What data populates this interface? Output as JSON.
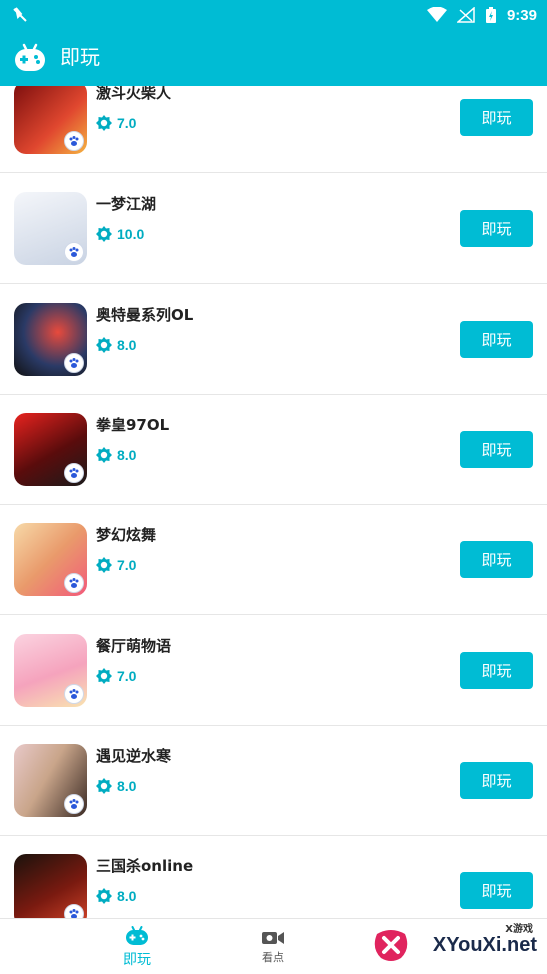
{
  "status_bar": {
    "time": "9:39"
  },
  "app_bar": {
    "title": "即玩"
  },
  "games": [
    {
      "name": "激斗火柴人",
      "score": "7.0",
      "button": "即玩",
      "bg": "#c0392b"
    },
    {
      "name": "一梦江湖",
      "score": "10.0",
      "button": "即玩",
      "bg": "#e8ecf2"
    },
    {
      "name": "奥特曼系列OL",
      "score": "8.0",
      "button": "即玩",
      "bg": "#1e2a44"
    },
    {
      "name": "拳皇97OL",
      "score": "8.0",
      "button": "即玩",
      "bg": "#8b1a1a"
    },
    {
      "name": "梦幻炫舞",
      "score": "7.0",
      "button": "即玩",
      "bg": "#f2c28a"
    },
    {
      "name": "餐厅萌物语",
      "score": "7.0",
      "button": "即玩",
      "bg": "#f7b6c8"
    },
    {
      "name": "遇见逆水寒",
      "score": "8.0",
      "button": "即玩",
      "bg": "#d9c3b0"
    },
    {
      "name": "三国杀online",
      "score": "8.0",
      "button": "即玩",
      "bg": "#2a1a12"
    }
  ],
  "tabs": [
    {
      "label": "即玩",
      "icon": "gamepad-icon"
    },
    {
      "label": "看点",
      "icon": "video-camera-icon"
    }
  ],
  "watermark": {
    "small": "X游戏",
    "big": "XYouXi.net"
  },
  "colors": {
    "primary": "#00BCD4",
    "score": "#00ACC1"
  }
}
